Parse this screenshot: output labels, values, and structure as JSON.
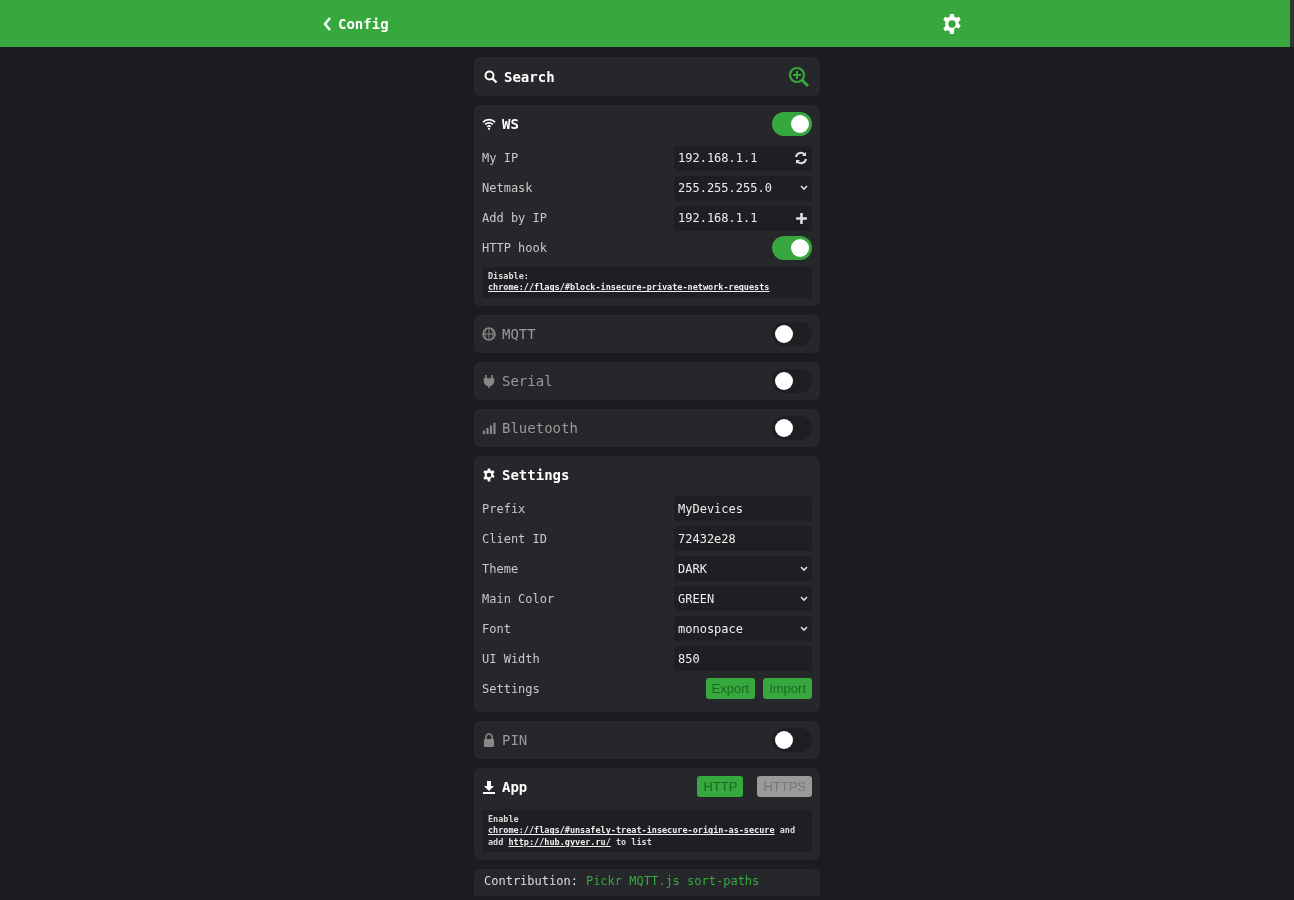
{
  "header": {
    "title": "Config"
  },
  "search": {
    "placeholder": "Search"
  },
  "cards": [
    {
      "title": "WS",
      "on": true,
      "rows": [
        {
          "kind": "input-refresh",
          "label": "My IP",
          "value": "192.168.1.1"
        },
        {
          "kind": "select",
          "label": "Netmask",
          "value": "255.255.255.0"
        },
        {
          "kind": "input-add",
          "label": "Add by IP",
          "value": "192.168.1.1"
        },
        {
          "kind": "toggle",
          "label": "HTTP hook",
          "on": true
        }
      ],
      "note": {
        "parts": [
          {
            "text": "Disable:"
          },
          {
            "link": "chrome://flags/#block-insecure-private-network-requests"
          }
        ]
      }
    },
    {
      "title": "MQTT",
      "on": false
    },
    {
      "title": "Serial",
      "on": false
    },
    {
      "title": "Bluetooth",
      "on": false
    },
    {
      "title": "Settings",
      "rows": [
        {
          "kind": "input",
          "label": "Prefix",
          "value": "MyDevices"
        },
        {
          "kind": "input",
          "label": "Client ID",
          "value": "72432e28"
        },
        {
          "kind": "select",
          "label": "Theme",
          "value": "DARK"
        },
        {
          "kind": "select",
          "label": "Main Color",
          "value": "GREEN"
        },
        {
          "kind": "select",
          "label": "Font",
          "value": "monospace"
        },
        {
          "kind": "input",
          "label": "UI Width",
          "value": "850"
        },
        {
          "kind": "buttons",
          "label": "Settings",
          "buttons": [
            "Export",
            "Import"
          ]
        }
      ]
    },
    {
      "title": "PIN",
      "on": false
    },
    {
      "title": "App",
      "modes": [
        {
          "label": "HTTP",
          "selected": true
        },
        {
          "label": "HTTPS",
          "selected": false
        }
      ],
      "note": {
        "parts": [
          {
            "text": "Enable"
          },
          {
            "link": "chrome://flags/#unsafely-treat-insecure-origin-as-secure"
          },
          {
            "text": "and add"
          },
          {
            "link": "http://hub.gyver.ru/"
          },
          {
            "text": "to list"
          }
        ]
      }
    }
  ],
  "footer": {
    "label": "Contribution:",
    "value": "Pickr MQTT.js sort-paths"
  }
}
